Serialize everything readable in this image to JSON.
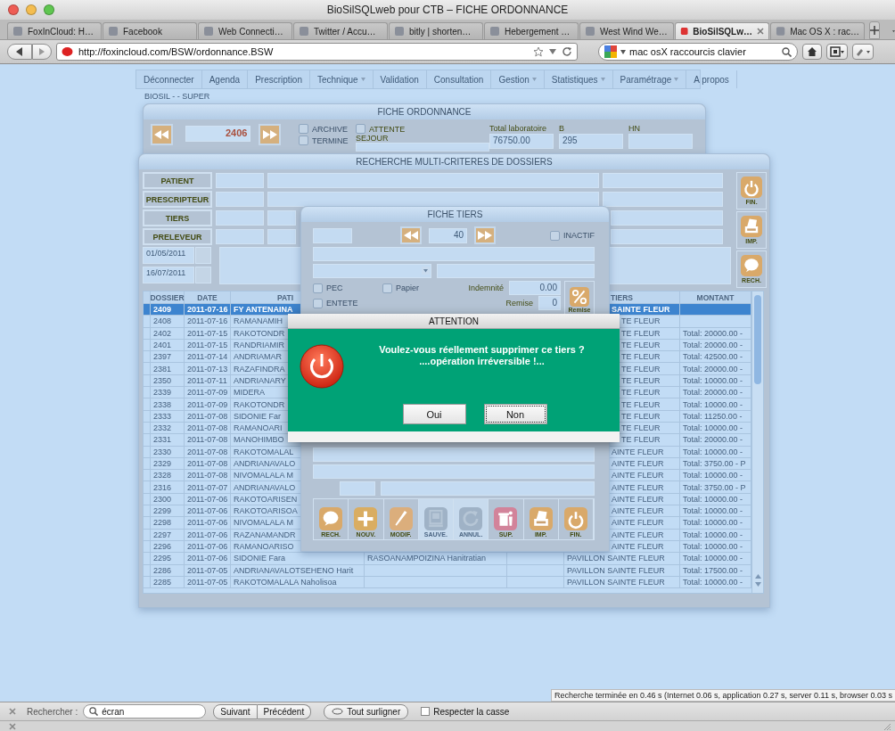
{
  "browser": {
    "title": "BioSilSQLweb pour CTB – FICHE ORDONNANCE",
    "tabs": [
      {
        "label": "FoxInCloud: H…",
        "selected": false
      },
      {
        "label": "Facebook",
        "selected": false
      },
      {
        "label": "Web Connecti…",
        "selected": false
      },
      {
        "label": "Twitter / Accu…",
        "selected": false
      },
      {
        "label": "bitly | shorten…",
        "selected": false
      },
      {
        "label": "Hebergement …",
        "selected": false
      },
      {
        "label": "West Wind We…",
        "selected": false
      },
      {
        "label": "BioSilSQLw…",
        "selected": true
      },
      {
        "label": "Mac OS X : rac…",
        "selected": false
      }
    ],
    "url": "http://foxincloud.com/BSW/ordonnance.BSW",
    "search_value": "mac osX raccourcis clavier"
  },
  "app": {
    "menu": [
      {
        "label": "Déconnecter",
        "dropdown": false
      },
      {
        "label": "Agenda",
        "dropdown": false
      },
      {
        "label": "Prescription",
        "dropdown": false
      },
      {
        "label": "Technique",
        "dropdown": true
      },
      {
        "label": "Validation",
        "dropdown": false
      },
      {
        "label": "Consultation",
        "dropdown": false
      },
      {
        "label": "Gestion",
        "dropdown": true
      },
      {
        "label": "Statistiques",
        "dropdown": true
      },
      {
        "label": "Paramétrage",
        "dropdown": true
      },
      {
        "label": "A propos",
        "dropdown": false
      }
    ],
    "user": "BIOSIL - - SUPER"
  },
  "fiche_ordonnance": {
    "title": "FICHE ORDONNANCE",
    "number": "2406",
    "checks": [
      {
        "label": "ARCHIVE",
        "checked": false
      },
      {
        "label": "TERMINE",
        "checked": false
      }
    ],
    "attente": {
      "label": "ATTENTE",
      "checked": false
    },
    "sejour_label": "SEJOUR",
    "totals": [
      {
        "label": "Total laboratoire",
        "value": "76750.00"
      },
      {
        "label": "B",
        "value": "295"
      },
      {
        "label": "HN"
      }
    ]
  },
  "recherche": {
    "title": "RECHERCHE MULTI-CRITERES DE DOSSIERS",
    "criteria": [
      "PATIENT",
      "PRESCRIPTEUR",
      "TIERS",
      "PRELEVEUR"
    ],
    "dates": [
      "01/05/2011",
      "16/07/2011"
    ],
    "side_buttons": [
      {
        "label": "FIN.",
        "kind": "power"
      },
      {
        "label": "IMP.",
        "kind": "printer"
      },
      {
        "label": "RECH.",
        "kind": "bubble"
      }
    ],
    "columns": {
      "dossier": "DOSSIER",
      "date": "DATE",
      "patient": "PATI",
      "tiers": "TIERS",
      "montant": "MONTANT"
    },
    "rows": [
      {
        "dossier": "2409",
        "date": "2011-07-16",
        "patient": "FY ANTENAINA",
        "tiers": "SAINTE FLEUR",
        "selected": true
      },
      {
        "dossier": "2408",
        "date": "2011-07-16",
        "patient": "RAMANAMIH",
        "tiers": "TE FLEUR",
        "selected": false
      },
      {
        "dossier": "2402",
        "date": "2011-07-15",
        "patient": "RAKOTONDR",
        "tiers": "TE FLEUR",
        "montant": "Total: 20000.00 -",
        "selected": false
      },
      {
        "dossier": "2401",
        "date": "2011-07-15",
        "patient": "RANDRIAMIR",
        "tiers": "TE FLEUR",
        "montant": "Total: 20000.00 -",
        "selected": false
      },
      {
        "dossier": "2397",
        "date": "2011-07-14",
        "patient": "ANDRIAMAR",
        "tiers": "TE FLEUR",
        "montant": "Total: 42500.00 -",
        "selected": false
      },
      {
        "dossier": "2381",
        "date": "2011-07-13",
        "patient": "RAZAFINDRA",
        "tiers": "TE FLEUR",
        "montant": "Total: 20000.00 -",
        "selected": false
      },
      {
        "dossier": "2350",
        "date": "2011-07-11",
        "patient": "ANDRIANARY",
        "tiers": "TE FLEUR",
        "montant": "Total: 10000.00 -",
        "selected": false
      },
      {
        "dossier": "2339",
        "date": "2011-07-09",
        "patient": "MIDERA",
        "tiers": "TE FLEUR",
        "montant": "Total: 20000.00 -",
        "selected": false
      },
      {
        "dossier": "2338",
        "date": "2011-07-09",
        "patient": "RAKOTONDR",
        "tiers": "TE FLEUR",
        "montant": "Total: 10000.00 -",
        "selected": false
      },
      {
        "dossier": "2333",
        "date": "2011-07-08",
        "patient": "SIDONIE Far",
        "tiers": "TE FLEUR",
        "montant": "Total: 11250.00 -",
        "selected": false
      },
      {
        "dossier": "2332",
        "date": "2011-07-08",
        "patient": "RAMANOARI",
        "tiers": "TE FLEUR",
        "montant": "Total: 10000.00 -",
        "selected": false
      },
      {
        "dossier": "2331",
        "date": "2011-07-08",
        "patient": "MANOHIMBO",
        "tiers": "TE FLEUR",
        "montant": "Total: 20000.00 -",
        "selected": false
      },
      {
        "dossier": "2330",
        "date": "2011-07-08",
        "patient": "RAKOTOMALAL",
        "tiers": "AINTE FLEUR",
        "montant": "Total: 10000.00 -",
        "selected": false
      },
      {
        "dossier": "2329",
        "date": "2011-07-08",
        "patient": "ANDRIANAVALO",
        "tiers": "AINTE FLEUR",
        "montant": "Total: 3750.00 - P",
        "selected": false
      },
      {
        "dossier": "2328",
        "date": "2011-07-08",
        "patient": "NIVOMALALA M",
        "tiers": "AINTE FLEUR",
        "montant": "Total: 10000.00 -",
        "selected": false
      },
      {
        "dossier": "2316",
        "date": "2011-07-07",
        "patient": "ANDRIANAVALO",
        "tiers": "AINTE FLEUR",
        "montant": "Total: 3750.00 - P",
        "selected": false
      },
      {
        "dossier": "2300",
        "date": "2011-07-06",
        "patient": "RAKOTOARISEN",
        "tiers": "AINTE FLEUR",
        "montant": "Total: 10000.00 -",
        "selected": false
      },
      {
        "dossier": "2299",
        "date": "2011-07-06",
        "patient": "RAKOTOARISOA",
        "tiers": "AINTE FLEUR",
        "montant": "Total: 10000.00 -",
        "selected": false
      },
      {
        "dossier": "2298",
        "date": "2011-07-06",
        "patient": "NIVOMALALA M",
        "tiers": "AINTE FLEUR",
        "montant": "Total: 10000.00 -",
        "selected": false
      },
      {
        "dossier": "2297",
        "date": "2011-07-06",
        "patient": "RAZANAMANDR",
        "tiers": "AINTE FLEUR",
        "montant": "Total: 10000.00 -",
        "selected": false
      },
      {
        "dossier": "2296",
        "date": "2011-07-06",
        "patient": "RAMANOARISO",
        "tiers": "AINTE FLEUR",
        "montant": "Total: 10000.00 -",
        "selected": false
      },
      {
        "dossier": "2295",
        "date": "2011-07-06",
        "patient": "SIDONIE Fara",
        "column_4": "RASOANAMPOIZINA Hanitratian",
        "tiers": "PAVILLON SAINTE FLEUR",
        "montant": "Total: 10000.00 -",
        "selected": false
      },
      {
        "dossier": "2286",
        "date": "2011-07-05",
        "patient": "ANDRIANAVALOTSEHENO Harit",
        "tiers": "PAVILLON SAINTE FLEUR",
        "montant": "Total: 17500.00 -",
        "selected": false
      },
      {
        "dossier": "2285",
        "date": "2011-07-05",
        "patient": "RAKOTOMALALA Naholisoa",
        "tiers": "PAVILLON SAINTE FLEUR",
        "montant": "Total: 10000.00 -",
        "selected": false
      }
    ]
  },
  "fiche_tiers": {
    "title": "FICHE TIERS",
    "number": "40",
    "inactif": {
      "label": "INACTIF",
      "checked": false
    },
    "pec": {
      "label": "PEC",
      "checked": false
    },
    "papier": {
      "label": "Papier",
      "checked": false
    },
    "entete": {
      "label": "ENTETE",
      "checked": false
    },
    "indemnite": {
      "label": "Indemnité",
      "value": "0.00"
    },
    "remise": {
      "label": "Remise",
      "value": "0"
    },
    "remise_button": "Remise",
    "toolbar": [
      {
        "label": "RECH.",
        "kind": "bubble",
        "disabled": false
      },
      {
        "label": "NOUV.",
        "kind": "plus",
        "disabled": false
      },
      {
        "label": "MODIF.",
        "kind": "pencil",
        "disabled": false
      },
      {
        "label": "SAUVE.",
        "kind": "disk",
        "disabled": true
      },
      {
        "label": "ANNUL.",
        "kind": "undo",
        "disabled": true
      },
      {
        "label": "SUP.",
        "kind": "trash",
        "disabled": false
      },
      {
        "label": "IMP.",
        "kind": "printer",
        "disabled": false
      },
      {
        "label": "FIN.",
        "kind": "power",
        "disabled": false
      }
    ]
  },
  "dialog": {
    "title": "ATTENTION",
    "lines": [
      "Voulez-vous réellement supprimer ce tiers ?",
      "....opération irréversible !..."
    ],
    "buttons": [
      {
        "label": "Oui",
        "focused": false
      },
      {
        "label": "Non",
        "focused": true
      }
    ]
  },
  "status": "Recherche terminée en 0.46 s (Internet 0.06 s, application 0.27 s, server 0.11 s, browser 0.03 s",
  "find_bar": {
    "label": "Rechercher :",
    "value": "écran",
    "buttons": [
      "Suivant",
      "Précédent"
    ],
    "highlight": "Tout surligner",
    "match_case": {
      "label": "Respecter la casse",
      "checked": false
    }
  }
}
